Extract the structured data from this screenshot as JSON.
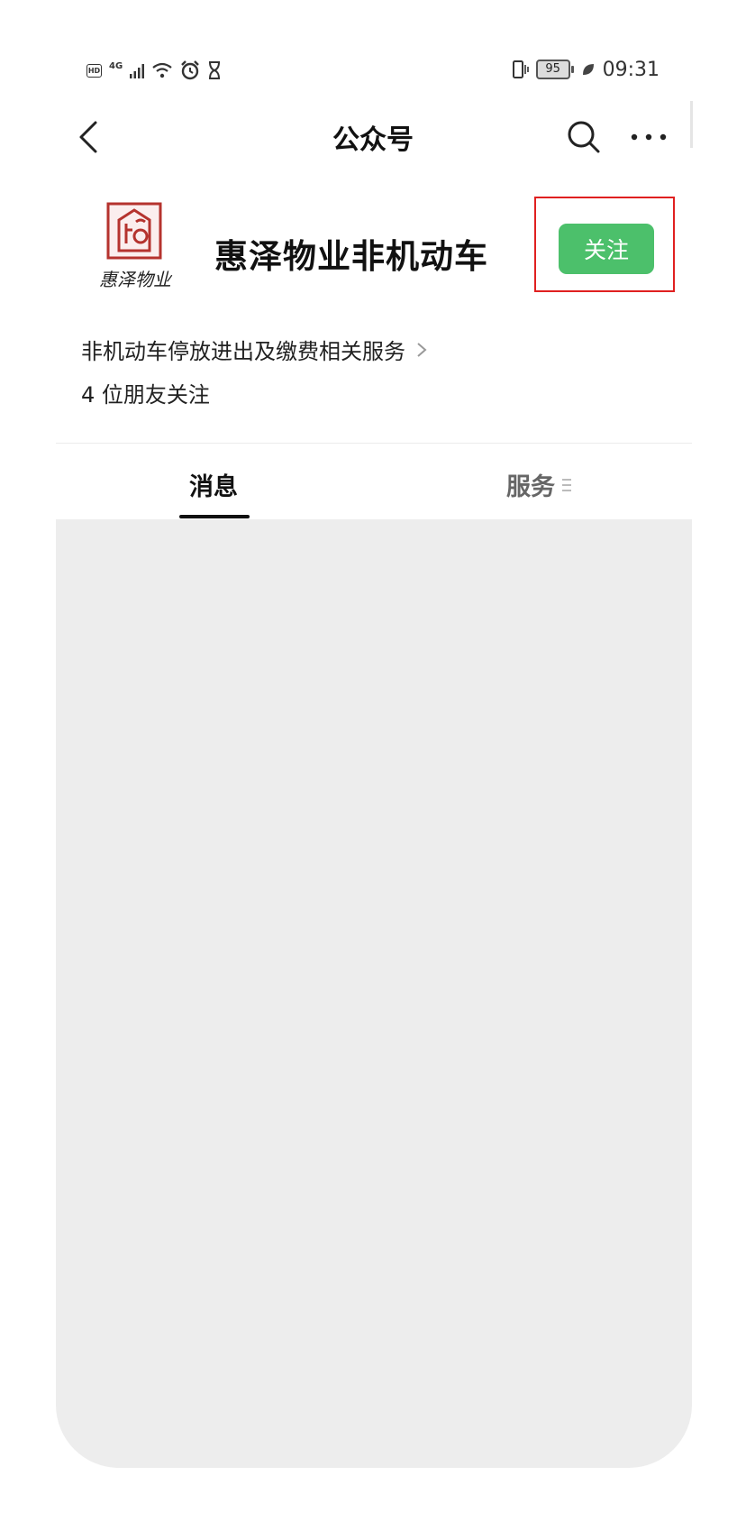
{
  "status_bar": {
    "hd": "HD",
    "network": "4G",
    "battery": "95",
    "time": "09:31"
  },
  "nav": {
    "title": "公众号",
    "icons": [
      "back-icon",
      "search-icon",
      "more-icon"
    ]
  },
  "account": {
    "logo_text": "惠泽物业",
    "name": "惠泽物业非机动车",
    "follow_label": "关注",
    "description": "非机动车停放进出及缴费相关服务",
    "friends": "4 位朋友关注"
  },
  "tabs": {
    "messages": "消息",
    "services": "服务"
  },
  "colors": {
    "accent_green": "#4cc06b",
    "highlight_red": "#e02020",
    "content_bg": "#ededed",
    "logo_red": "#b5332e"
  }
}
